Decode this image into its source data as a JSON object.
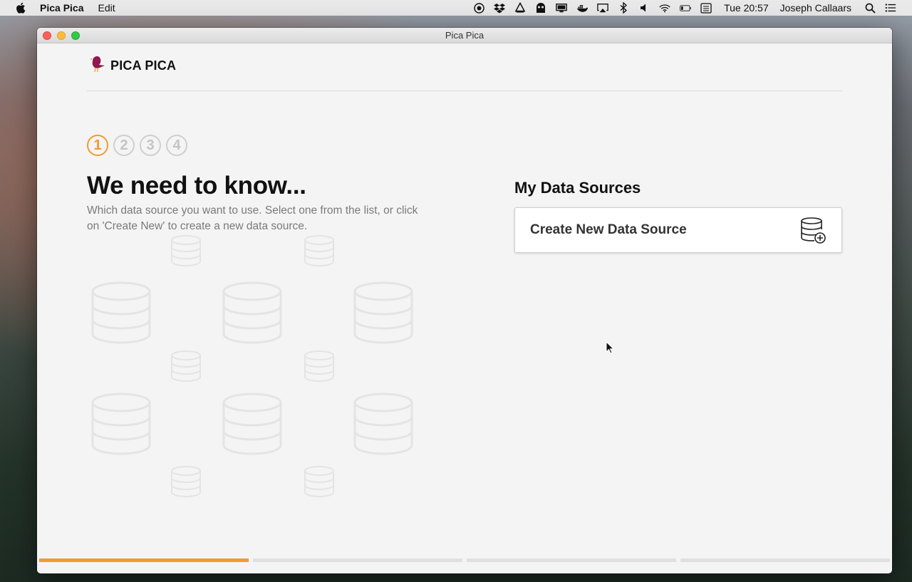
{
  "menubar": {
    "app_name": "Pica Pica",
    "menus": [
      "Edit"
    ],
    "clock": "Tue 20:57",
    "user": "Joseph Callaars",
    "status_icons": [
      "record-icon",
      "dropbox-icon",
      "app-icon",
      "alien-icon",
      "display-icon",
      "docker-icon",
      "airplay-icon",
      "bluetooth-icon",
      "volume-icon",
      "wifi-icon",
      "battery-icon",
      "keyboard-icon"
    ]
  },
  "window": {
    "title": "Pica Pica"
  },
  "header": {
    "brand": "PICA PICA"
  },
  "steps": [
    "1",
    "2",
    "3",
    "4"
  ],
  "active_step": 1,
  "intro": {
    "headline": "We need to know...",
    "description": "Which data source you want to use. Select one from the list, or click on 'Create New' to create a new data source."
  },
  "data_sources": {
    "title": "My Data Sources",
    "create_label": "Create New Data Source"
  },
  "progress": {
    "segments": 4,
    "completed": 1
  },
  "colors": {
    "accent": "#f39a2c",
    "brand_bird": "#8e1a4f"
  }
}
